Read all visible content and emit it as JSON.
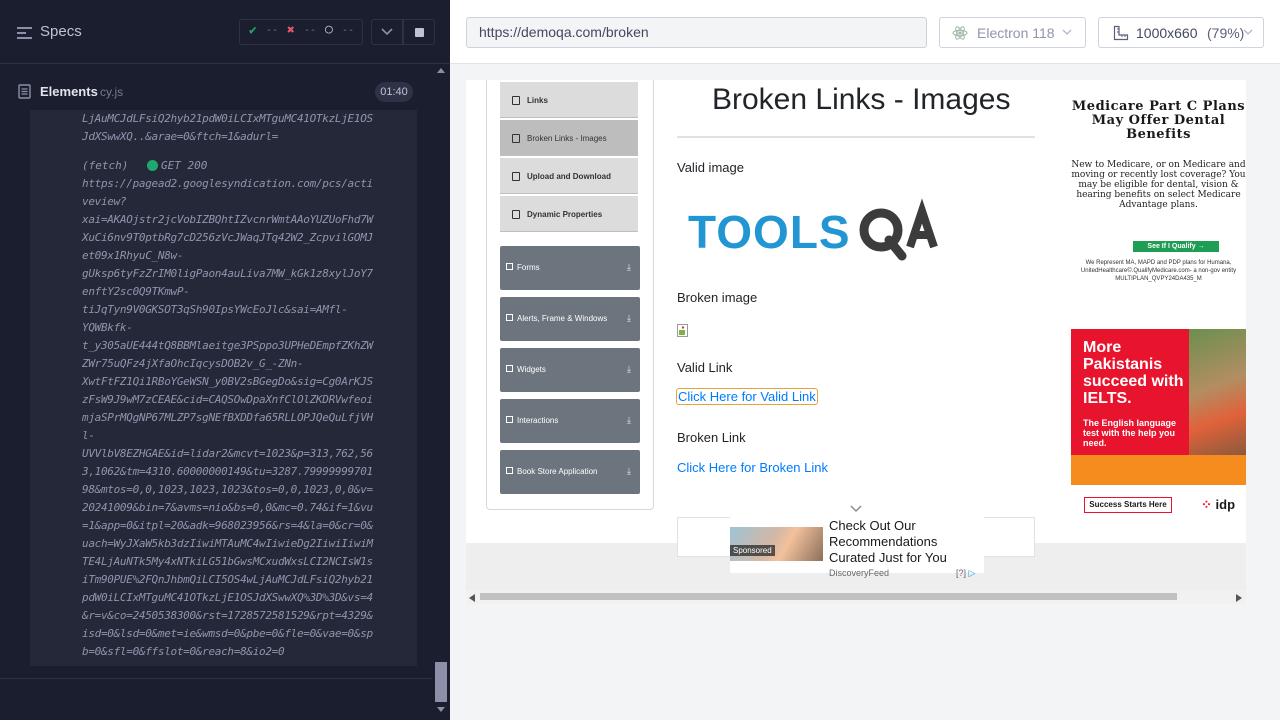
{
  "runner": {
    "specs_label": "Specs",
    "stats": {
      "passed": "--",
      "failed": "--",
      "pending": "--"
    },
    "elements_title": "Elements",
    "elements_file": "cy.js",
    "timer": "01:40",
    "log_head": [
      "LjAuMCJdLFsiQ2hyb21pdW0iLCIxMTguMC41OTkzLjE1OS",
      "JdXSwwXQ..&arae=0&ftch=1&adurl="
    ],
    "fetch_label": "(fetch)",
    "fetch_status": "GET 200",
    "log_lines": [
      "https://pagead2.googlesyndication.com/pcs/acti",
      "veview?",
      "xai=AKAOjstr2jcVobIZBQhtIZvcnrWmtAAoYUZUoFhd7W",
      "XuCi6nv9T0ptbRg7cD256zVcJWaqJTq42W2_ZcpvilGOMJ",
      "et09x1RhyuC_N8w-",
      "gUksp6tyFzZrIM0ligPaon4auLiva7MW_kGk1z8xylJoY7",
      "enftY2sc0Q9TKmwP-",
      "tiJqTyn9V0GKSOT3qSh90IpsYWcEoJlc&sai=AMfl-",
      "YQWBkfk-",
      "t_y305aUE444tQ8BBMlaeitge3PSppo3UPHeDEmpfZKhZW",
      "ZWr75uQFz4jXfaOhcIqcysDOB2v_G_-ZNn-",
      "XwtFtFZ1Qi1RBoYGeWSN_y0BV2sBGegDo&sig=Cg0ArKJS",
      "zFsW9J9wM7zCEAE&cid=CAQSOwDpaXnfClOlZKDRVwfeoi",
      "mjaSPrMQgNP67MLZP7sgNEfBXDDfa65RLLOPJQeQuLfjVH",
      "l-",
      "UVVlbV8EZHGAE&id=lidar2&mcvt=1023&p=313,762,56",
      "3,1062&tm=4310.60000000149&tu=3287.79999999701",
      "98&mtos=0,0,1023,1023,1023&tos=0,0,1023,0,0&v=",
      "20241009&bin=7&avms=nio&bs=0,0&mc=0.74&if=1&vu",
      "=1&app=0&itpl=20&adk=968023956&rs=4&la=0&cr=0&",
      "uach=WyJXaW5kb3dzIiwiMTAuMC4wIiwieDg2IiwiIiwiM",
      "TE4LjAuNTk5My4xNTkiLG51bGwsMCxudWxsLCI2NCIsW1s",
      "iTm90PUE%2FQnJhbmQiLCI5OS4wLjAuMCJdLFsiQ2hyb21",
      "pdW0iLCIxMTguMC41OTkzLjE1OSJdXSwwXQ%3D%3D&vs=4",
      "&r=v&co=2450538300&rst=1728572581529&rpt=4329&",
      "isd=0&lsd=0&met=ie&wmsd=0&pbe=0&fle=0&vae=0&sp",
      "b=0&sfl=0&ffslot=0&reach=8&io2=0"
    ]
  },
  "toolbar": {
    "url": "https://demoqa.com/broken",
    "browser": "Electron 118",
    "viewport": "1000x660",
    "zoom": "(79%)"
  },
  "aut": {
    "menu": {
      "items": [
        "Links",
        "Broken Links - Images",
        "Upload and Download",
        "Dynamic Properties"
      ],
      "groups": [
        "Forms",
        "Alerts, Frame & Windows",
        "Widgets",
        "Interactions",
        "Book Store Application"
      ]
    },
    "heading": "Broken Links - Images",
    "valid_image_label": "Valid image",
    "logo_text": "TOOLSQA",
    "broken_image_label": "Broken image",
    "valid_link_label": "Valid Link",
    "valid_link_text": "Click Here for Valid Link",
    "broken_link_label": "Broken Link",
    "broken_link_text": "Click Here for Broken Link",
    "ad1": {
      "title": "Medicare Part C Plans May Offer Dental Benefits",
      "body": "New to Medicare, or on Medicare and moving or recently lost coverage? You may be eligible for dental, vision & hearing benefits on select Medicare Advantage plans.",
      "button": "See If I Qualify →",
      "footer": "We Represent MA, MAPD and PDP plans for Humana, UnitedHealthcare©.QualifyMedicare.com- a non-gov entity MULTIPLAN_QVPY24DA435_M"
    },
    "ad2": {
      "headline": "More Pakistanis succeed with IELTS.",
      "sub": "The English language test with the help you need.",
      "cta": "Success Starts Here",
      "logo": "idp"
    },
    "sponsored": {
      "tag": "Sponsored",
      "title": "Check Out Our Recommendations Curated Just for You",
      "source": "DiscoveryFeed",
      "info": "[?]"
    }
  },
  "colors": {
    "runner_bg": "#1b1e2e",
    "pass": "#1fa971",
    "fail": "#e45770",
    "link": "#007bff",
    "menu_group": "#6c757d",
    "ielts_red": "#e8132d"
  }
}
